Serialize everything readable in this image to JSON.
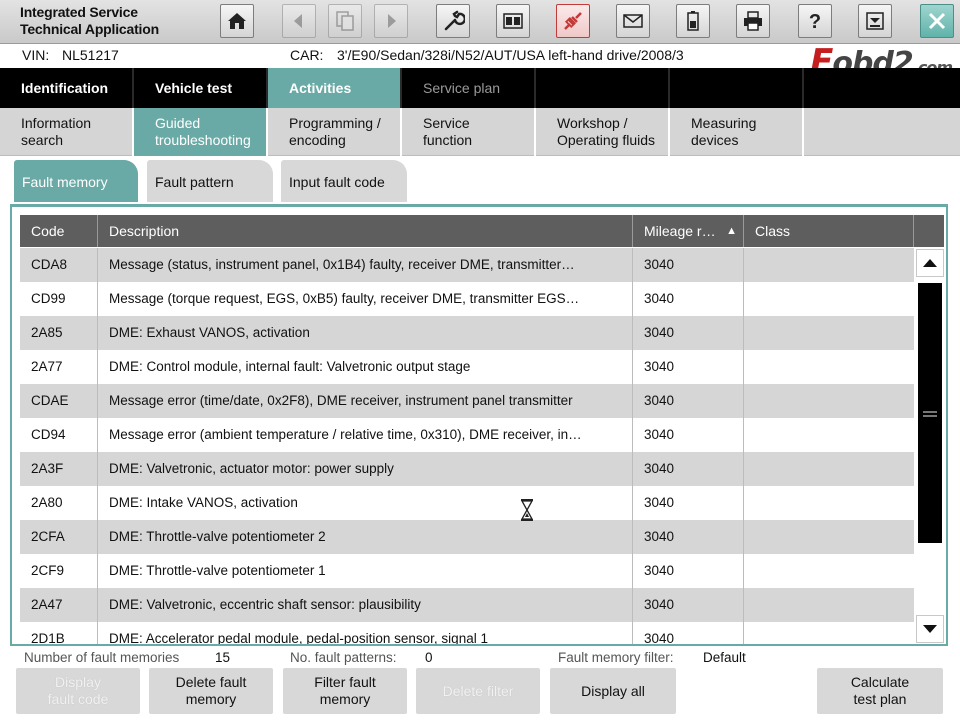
{
  "app": {
    "title_line1": "Integrated Service",
    "title_line2": "Technical Application"
  },
  "toolbar": {
    "buttons": [
      {
        "icon": "home-icon"
      },
      {
        "icon": "back-icon"
      },
      {
        "icon": "pages-icon"
      },
      {
        "icon": "forward-icon"
      },
      {
        "icon": "wrench-icon"
      },
      {
        "icon": "split-screen-icon"
      },
      {
        "icon": "connection-icon"
      },
      {
        "icon": "mail-icon"
      },
      {
        "icon": "battery-icon"
      },
      {
        "icon": "printer-icon"
      },
      {
        "icon": "help-icon"
      },
      {
        "icon": "download-icon"
      },
      {
        "icon": "close-icon"
      }
    ]
  },
  "vehicle": {
    "vin_label": "VIN:",
    "vin": "NL51217",
    "car_label": "CAR:",
    "car": "3'/E90/Sedan/328i/N52/AUT/USA left-hand drive/2008/3"
  },
  "logo": {
    "first": "E",
    "rest": "obd2",
    "tail": ".com"
  },
  "main_nav": [
    {
      "label": "Identification"
    },
    {
      "label": "Vehicle test"
    },
    {
      "label": "Activities"
    },
    {
      "label": "Service plan"
    },
    {
      "label": ""
    },
    {
      "label": ""
    },
    {
      "label": ""
    }
  ],
  "sub_nav": [
    {
      "line1": "Information",
      "line2": "search"
    },
    {
      "line1": "Guided",
      "line2": "troubleshooting"
    },
    {
      "line1": "Programming /",
      "line2": "encoding"
    },
    {
      "line1": "Service",
      "line2": "function"
    },
    {
      "line1": "Workshop /",
      "line2": "Operating fluids"
    },
    {
      "line1": "Measuring",
      "line2": "devices"
    },
    {
      "line1": "",
      "line2": ""
    }
  ],
  "sub_tabs": [
    "Fault memory",
    "Fault pattern",
    "Input fault code"
  ],
  "table": {
    "columns": [
      "Code",
      "Description",
      "Mileage r…",
      "Class"
    ],
    "rows": [
      [
        "CDA8",
        "Message (status, instrument panel, 0x1B4) faulty, receiver DME, transmitter…",
        "3040",
        ""
      ],
      [
        "CD99",
        "Message (torque request, EGS, 0xB5) faulty, receiver DME, transmitter EGS…",
        "3040",
        ""
      ],
      [
        "2A85",
        "DME: Exhaust VANOS, activation",
        "3040",
        ""
      ],
      [
        "2A77",
        "DME: Control module, internal fault: Valvetronic output stage",
        "3040",
        ""
      ],
      [
        "CDAE",
        "Message error (time/date, 0x2F8), DME receiver, instrument panel transmitter",
        "3040",
        ""
      ],
      [
        "CD94",
        "Message error (ambient temperature / relative time, 0x310), DME receiver, in…",
        "3040",
        ""
      ],
      [
        "2A3F",
        "DME: Valvetronic, actuator motor: power supply",
        "3040",
        ""
      ],
      [
        "2A80",
        "DME: Intake VANOS, activation",
        "3040",
        ""
      ],
      [
        "2CFA",
        "DME: Throttle-valve potentiometer 2",
        "3040",
        ""
      ],
      [
        "2CF9",
        "DME: Throttle-valve potentiometer 1",
        "3040",
        ""
      ],
      [
        "2A47",
        "DME: Valvetronic, eccentric shaft sensor: plausibility",
        "3040",
        ""
      ],
      [
        "2D1B",
        "DME: Accelerator pedal module, pedal-position sensor, signal 1",
        "3040",
        ""
      ]
    ]
  },
  "status": {
    "fault_mem_label": "Number of fault memories",
    "fault_mem_count": "15",
    "patterns_label": "No. fault patterns:",
    "patterns_count": "0",
    "filter_label": "Fault memory filter:",
    "filter_value": "Default"
  },
  "bottom_buttons": [
    {
      "line1": "Display",
      "line2": "fault code"
    },
    {
      "line1": "Delete fault",
      "line2": "memory"
    },
    {
      "line1": "Filter fault",
      "line2": "memory"
    },
    {
      "line1": "Delete filter",
      "line2": ""
    },
    {
      "line1": "Display all",
      "line2": ""
    },
    {
      "line1": "Calculate",
      "line2": "test plan"
    }
  ],
  "colors": {
    "accent": "#6aaaa6",
    "header": "#5e5e5e",
    "nav": "#000000",
    "alt_row": "#d6d6d6"
  }
}
